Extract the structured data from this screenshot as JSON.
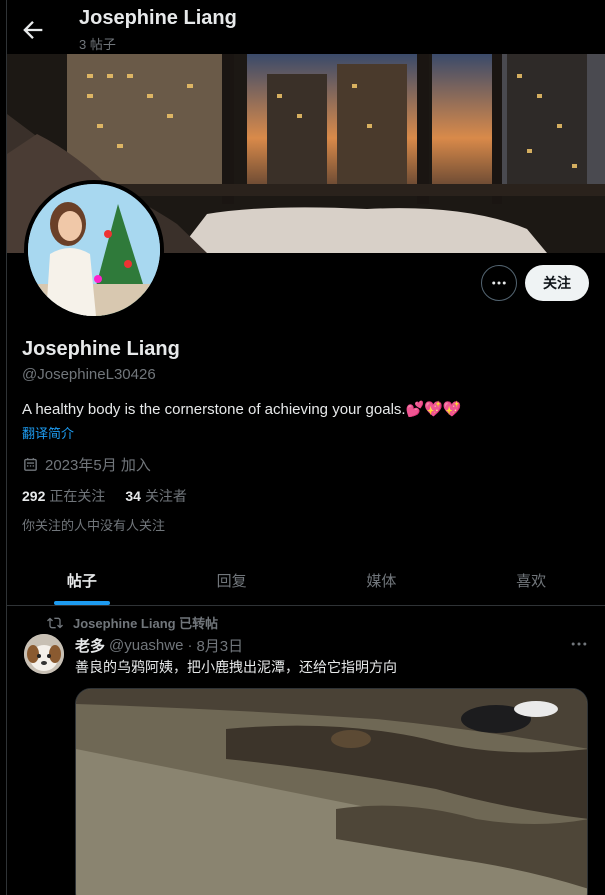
{
  "header": {
    "title": "Josephine Liang",
    "post_count": "3 帖子"
  },
  "profile": {
    "name": "Josephine Liang",
    "handle": "@JosephineL30426",
    "bio": "A healthy body is the cornerstone of achieving your goals.💕💖💖",
    "translate_label": "翻译简介",
    "joined": "2023年5月 加入",
    "following_count": "292",
    "following_label": "正在关注",
    "followers_count": "34",
    "followers_label": "关注者",
    "mutual_note": "你关注的人中没有人关注",
    "follow_button": "关注"
  },
  "tabs": [
    {
      "label": "帖子",
      "active": true
    },
    {
      "label": "回复",
      "active": false
    },
    {
      "label": "媒体",
      "active": false
    },
    {
      "label": "喜欢",
      "active": false
    }
  ],
  "tweet": {
    "retweet_label": "Josephine Liang 已转帖",
    "author": "老多",
    "handle": "@yuashwe",
    "separator": "·",
    "date": "8月3日",
    "text": "善良的乌鸦阿姨，把小鹿拽出泥潭，还给它指明方向"
  },
  "colors": {
    "accent": "#1d9bf0",
    "background": "#000000",
    "text": "#e7e9ea",
    "muted": "#71767b"
  }
}
